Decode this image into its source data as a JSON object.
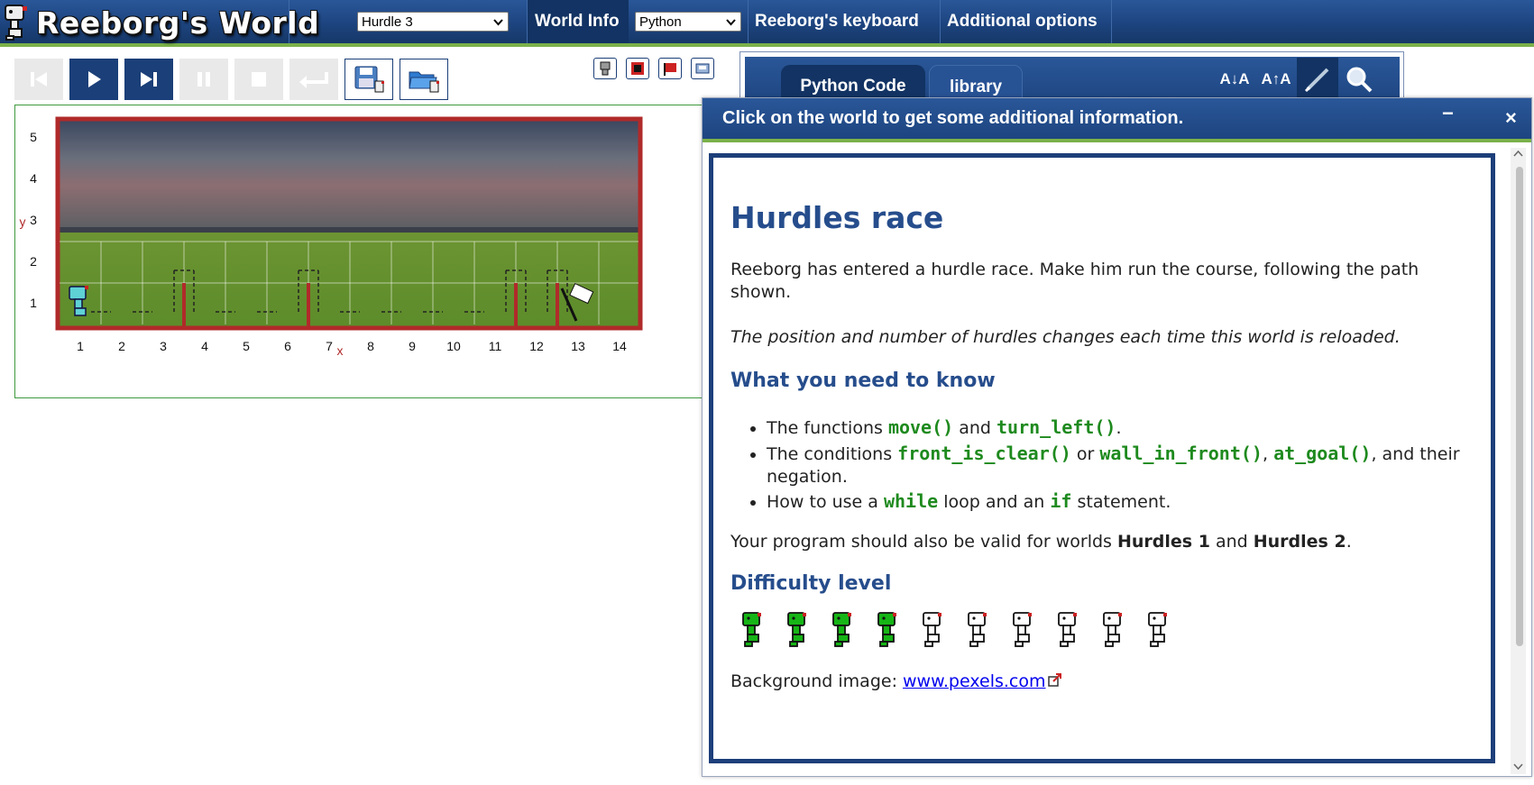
{
  "app": {
    "title": "Reeborg's World"
  },
  "topbar": {
    "world_select": "Hurdle 3",
    "world_info_label": "World Info",
    "language_select": "Python",
    "keyboard_label": "Reeborg's keyboard",
    "additional_options_label": "Additional options"
  },
  "controls": [
    {
      "name": "reverse-step-button",
      "icon": "skip-back-icon",
      "enabled": false
    },
    {
      "name": "run-button",
      "icon": "play-icon",
      "enabled": true
    },
    {
      "name": "step-button",
      "icon": "skip-forward-icon",
      "enabled": true
    },
    {
      "name": "pause-button",
      "icon": "pause-icon",
      "enabled": false
    },
    {
      "name": "stop-button",
      "icon": "stop-icon",
      "enabled": false
    },
    {
      "name": "reload-button",
      "icon": "return-icon",
      "enabled": false
    },
    {
      "name": "save-button",
      "icon": "floppy-icon",
      "enabled": true
    },
    {
      "name": "open-button",
      "icon": "folder-icon",
      "enabled": true
    }
  ],
  "world": {
    "x_label": "x",
    "y_label": "y",
    "x_ticks": [
      "1",
      "2",
      "3",
      "4",
      "5",
      "6",
      "7",
      "8",
      "9",
      "10",
      "11",
      "12",
      "13",
      "14"
    ],
    "y_ticks": [
      "1",
      "2",
      "3",
      "4",
      "5"
    ],
    "columns": 14,
    "rows": 5,
    "robot_position": {
      "x": 1,
      "y": 1
    },
    "goal_position": {
      "x": 13,
      "y": 1
    },
    "hurdles_east_of_x": [
      3,
      6,
      11,
      12
    ]
  },
  "editor": {
    "tabs": [
      "Python Code",
      "library"
    ],
    "decrease_font_label": "A↓A",
    "increase_font_label": "A↑A"
  },
  "dialog": {
    "title": "Click on the world to get some additional information.",
    "minimize_label": "−",
    "close_label": "×",
    "heading": "Hurdles race",
    "intro": "Reeborg has entered a hurdle race. Make him run the course, following the path shown.",
    "note": "The position and number of hurdles changes each time this world is reloaded.",
    "need_heading": "What you need to know",
    "bullet1": {
      "a": "The functions ",
      "code1": "move()",
      "b": " and ",
      "code2": "turn_left()",
      "c": "."
    },
    "bullet2": {
      "a": "The conditions ",
      "code1": "front_is_clear()",
      "b": " or ",
      "code2": "wall_in_front()",
      "c": ", ",
      "code3": "at_goal()",
      "d": ", and their negation."
    },
    "bullet3": {
      "a": "How to use a ",
      "code1": "while",
      "b": " loop and an ",
      "code2": "if",
      "c": " statement."
    },
    "valid": {
      "a": "Your program should also be valid for worlds ",
      "b1": "Hurdles 1",
      "c": " and ",
      "b2": "Hurdles 2",
      "d": "."
    },
    "difficulty_heading": "Difficulty level",
    "difficulty": {
      "filled": 4,
      "total": 10
    },
    "background_label": "Background image: ",
    "background_link": "www.pexels.com"
  },
  "colors": {
    "brand_blue": "#1d447f",
    "accent_green": "#7bb14a",
    "heading_blue": "#264d8c",
    "code_green": "#1e8a1e",
    "wall_red": "#b02a2a"
  }
}
